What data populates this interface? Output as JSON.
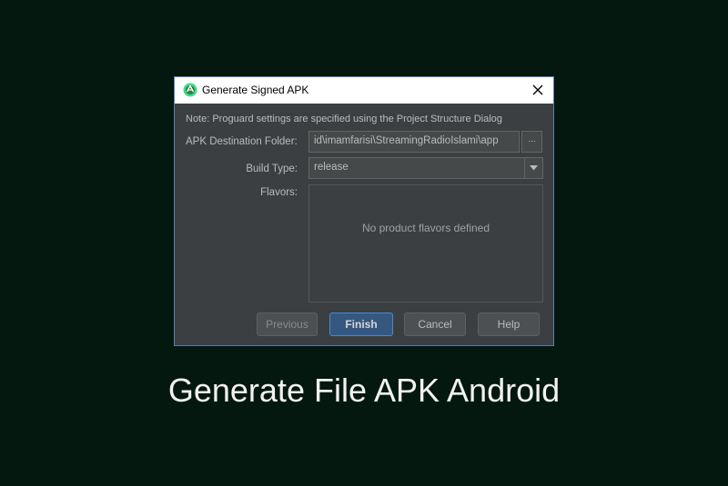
{
  "dialog": {
    "title": "Generate Signed APK",
    "icon": "android-studio-icon",
    "note": "Note: Proguard settings are specified using the Project Structure Dialog",
    "destination_label": "APK Destination Folder:",
    "destination_value": "id\\imamfarisi\\StreamingRadioIslami\\app",
    "browse_label": "...",
    "build_type_label": "Build Type:",
    "build_type_value": "release",
    "flavors_label": "Flavors:",
    "flavors_empty": "No product flavors defined",
    "buttons": {
      "previous": "Previous",
      "finish": "Finish",
      "cancel": "Cancel",
      "help": "Help"
    }
  },
  "caption": "Generate File APK Android",
  "colors": {
    "background": "#051810",
    "dialog": "#3c3f41",
    "accent": "#365880"
  }
}
